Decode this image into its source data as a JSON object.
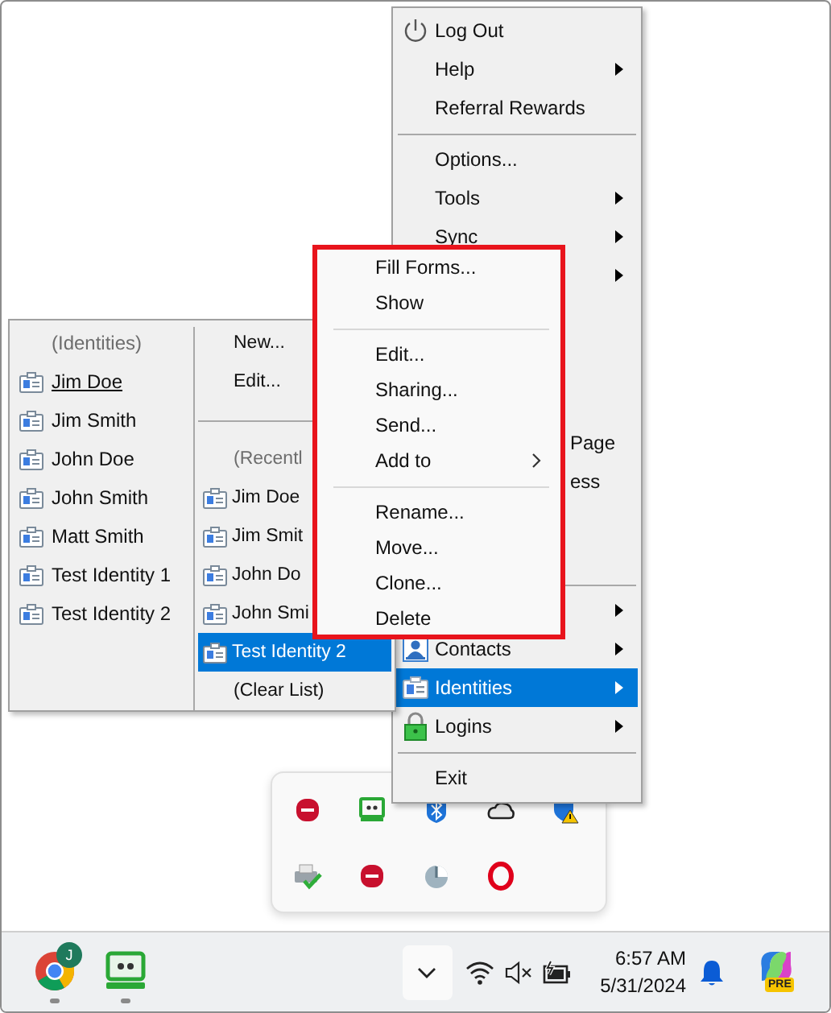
{
  "main_menu": {
    "items": [
      {
        "kind": "power",
        "label": "Log Out",
        "submenu": false,
        "selected": false
      },
      {
        "kind": "plain",
        "label": "Help",
        "submenu": true,
        "selected": false
      },
      {
        "kind": "plain",
        "label": "Referral Rewards",
        "submenu": false,
        "selected": false
      },
      {
        "kind": "separator"
      },
      {
        "kind": "plain",
        "label": "Options...",
        "submenu": false,
        "selected": false
      },
      {
        "kind": "plain",
        "label": "Tools",
        "submenu": true,
        "selected": false
      },
      {
        "kind": "plain",
        "label": "Sync",
        "submenu": true,
        "selected": false
      },
      {
        "kind": "covered",
        "submenu": true
      },
      {
        "kind": "fragment",
        "label": "Page"
      },
      {
        "kind": "fragment",
        "label": "ess"
      },
      {
        "kind": "separator"
      },
      {
        "kind": "covered",
        "submenu": true
      },
      {
        "kind": "contacts",
        "label": "Contacts",
        "submenu": true,
        "selected": false
      },
      {
        "kind": "identity",
        "label": "Identities",
        "submenu": true,
        "selected": true
      },
      {
        "kind": "lock",
        "label": "Logins",
        "submenu": true,
        "selected": false
      },
      {
        "kind": "separator"
      },
      {
        "kind": "plain",
        "label": "Exit",
        "submenu": false,
        "selected": false
      }
    ]
  },
  "identities_submenu": {
    "header": "(Identities)",
    "identities": [
      {
        "label": "Jim Doe",
        "hovered": true
      },
      {
        "label": "Jim Smith",
        "hovered": false
      },
      {
        "label": "John Doe",
        "hovered": false
      },
      {
        "label": "John Smith",
        "hovered": false
      },
      {
        "label": "Matt Smith",
        "hovered": false
      },
      {
        "label": "Test Identity 1",
        "hovered": false
      },
      {
        "label": "Test Identity 2",
        "hovered": false
      }
    ],
    "actions": [
      {
        "label": "New..."
      },
      {
        "label": "Edit..."
      }
    ],
    "recent_header": "(Recentl",
    "recent": [
      {
        "label": "Jim Doe",
        "selected": false
      },
      {
        "label": "Jim Smit",
        "selected": false
      },
      {
        "label": "John Do",
        "selected": false
      },
      {
        "label": "John Smi",
        "selected": false
      },
      {
        "label": "Test Identity 2",
        "selected": true
      }
    ],
    "clear_label": "(Clear List)"
  },
  "context_menu": {
    "items": [
      {
        "kind": "item",
        "label": "Fill Forms...",
        "submenu": false
      },
      {
        "kind": "item",
        "label": "Show",
        "submenu": false
      },
      {
        "kind": "separator"
      },
      {
        "kind": "item",
        "label": "Edit...",
        "submenu": false
      },
      {
        "kind": "item",
        "label": "Sharing...",
        "submenu": false
      },
      {
        "kind": "item",
        "label": "Send...",
        "submenu": false
      },
      {
        "kind": "item",
        "label": "Add to",
        "submenu": true
      },
      {
        "kind": "separator"
      },
      {
        "kind": "item",
        "label": "Rename...",
        "submenu": false
      },
      {
        "kind": "item",
        "label": "Move...",
        "submenu": false
      },
      {
        "kind": "item",
        "label": "Clone...",
        "submenu": false
      },
      {
        "kind": "item",
        "label": "Delete",
        "submenu": false
      }
    ]
  },
  "taskbar": {
    "profile_badge": "J",
    "copilot_badge": "PRE",
    "time": "6:57 AM",
    "date": "5/31/2024"
  }
}
